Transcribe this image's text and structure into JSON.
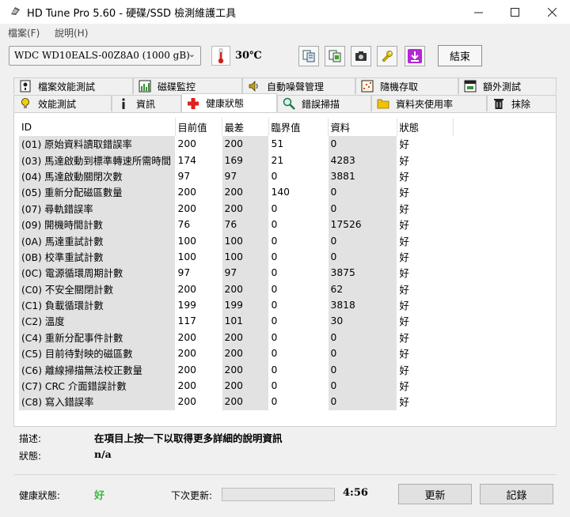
{
  "window": {
    "title": "HD Tune Pro 5.60 - 硬碟/SSD 檢測維護工具",
    "icons": [
      "hdtune-app-icon",
      "minimize-icon",
      "maximize-icon",
      "close-icon"
    ]
  },
  "menu": {
    "file": "檔案(F)",
    "help": "說明(H)"
  },
  "toolbar": {
    "drive": "WDC WD10EALS-00Z8A0 (1000 gB)",
    "temperature": "30℃",
    "exit_label": "結束",
    "buttons": [
      "copy-text-icon",
      "copy-info-icon",
      "screenshot-camera-icon",
      "options-wrench-icon",
      "save-download-icon"
    ]
  },
  "tabs_top": [
    {
      "label": "檔案效能測試",
      "icon": "file-benchmark-icon"
    },
    {
      "label": "磁碟監控",
      "icon": "disk-monitor-icon"
    },
    {
      "label": "自動噪聲管理",
      "icon": "speaker-icon"
    },
    {
      "label": "隨機存取",
      "icon": "random-access-icon"
    },
    {
      "label": "額外測試",
      "icon": "extra-tests-icon"
    }
  ],
  "tabs_bottom": [
    {
      "label": "效能測試",
      "icon": "lightbulb-icon"
    },
    {
      "label": "資訊",
      "icon": "info-icon"
    },
    {
      "label": "健康狀態",
      "icon": "health-cross-icon",
      "active": true
    },
    {
      "label": "錯誤掃描",
      "icon": "magnifier-icon"
    },
    {
      "label": "資料夾使用率",
      "icon": "folder-icon"
    },
    {
      "label": "抹除",
      "icon": "trash-icon"
    }
  ],
  "table": {
    "headers": [
      "ID",
      "目前值",
      "最差",
      "臨界值",
      "資料",
      "狀態"
    ],
    "rows": [
      [
        "(01) 原始資料讀取錯誤率",
        "200",
        "200",
        "51",
        "0",
        "好"
      ],
      [
        "(03) 馬達啟動到標準轉速所需時間",
        "174",
        "169",
        "21",
        "4283",
        "好"
      ],
      [
        "(04) 馬達啟動關閉次數",
        "97",
        "97",
        "0",
        "3881",
        "好"
      ],
      [
        "(05) 重新分配磁區數量",
        "200",
        "200",
        "140",
        "0",
        "好"
      ],
      [
        "(07) 尋軌錯誤率",
        "200",
        "200",
        "0",
        "0",
        "好"
      ],
      [
        "(09) 開機時間計數",
        "76",
        "76",
        "0",
        "17526",
        "好"
      ],
      [
        "(0A) 馬達重試計數",
        "100",
        "100",
        "0",
        "0",
        "好"
      ],
      [
        "(0B) 校準重試計數",
        "100",
        "100",
        "0",
        "0",
        "好"
      ],
      [
        "(0C) 電源循環周期計數",
        "97",
        "97",
        "0",
        "3875",
        "好"
      ],
      [
        "(C0) 不安全關閉計數",
        "200",
        "200",
        "0",
        "62",
        "好"
      ],
      [
        "(C1) 負載循環計數",
        "199",
        "199",
        "0",
        "3818",
        "好"
      ],
      [
        "(C2) 溫度",
        "117",
        "101",
        "0",
        "30",
        "好"
      ],
      [
        "(C4) 重新分配事件計數",
        "200",
        "200",
        "0",
        "0",
        "好"
      ],
      [
        "(C5) 目前待對映的磁區數",
        "200",
        "200",
        "0",
        "0",
        "好"
      ],
      [
        "(C6) 離線掃描無法校正數量",
        "200",
        "200",
        "0",
        "0",
        "好"
      ],
      [
        "(C7) CRC 介面錯誤計數",
        "200",
        "200",
        "0",
        "0",
        "好"
      ],
      [
        "(C8) 寫入錯誤率",
        "200",
        "200",
        "0",
        "0",
        "好"
      ]
    ]
  },
  "description": {
    "label": "描述:",
    "text": "在項目上按一下以取得更多詳細的說明資訊",
    "status_label": "狀態:",
    "status_value": "n/a"
  },
  "bottom": {
    "health_label": "健康狀態:",
    "health_value": "好",
    "health_color": "#3cb83c",
    "next_update_label": "下次更新:",
    "progress_percent": 0,
    "countdown": "4:56",
    "refresh_label": "更新",
    "log_label": "記錄"
  }
}
